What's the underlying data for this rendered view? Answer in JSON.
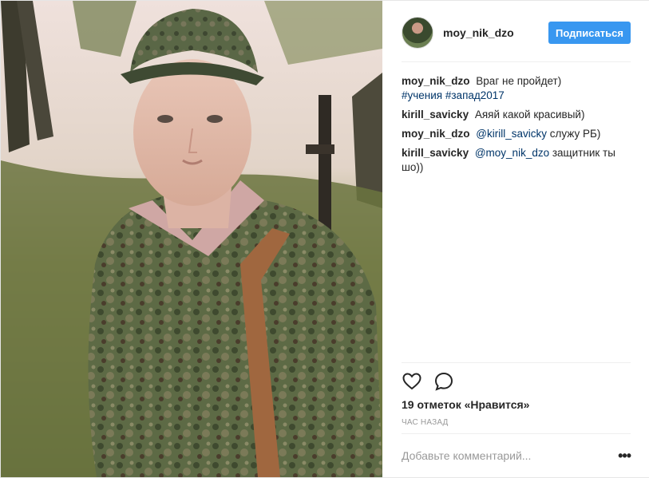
{
  "post": {
    "author": "moy_nik_dzo",
    "follow_label": "Подписаться",
    "comments": [
      {
        "author": "moy_nik_dzo",
        "text": "Враг не пройдет)",
        "hashtags": "#учения #запад2017"
      },
      {
        "author": "kirill_savicky",
        "text": "Аяяй какой красивый)"
      },
      {
        "author": "moy_nik_dzo",
        "mention": "@kirill_savicky",
        "text": "служу РБ)"
      },
      {
        "author": "kirill_savicky",
        "mention": "@moy_nik_dzo",
        "text": "защитник ты шо))"
      }
    ],
    "likes": "19 отметок «Нравится»",
    "time": "час назад",
    "comment_placeholder": "Добавьте комментарий...",
    "more_label": "•••"
  },
  "icons": {
    "like": "heart-icon",
    "comment": "comment-bubble-icon",
    "more": "ellipsis-icon"
  },
  "colors": {
    "follow_button": "#3897f0",
    "link": "#003569",
    "muted": "#999999"
  }
}
